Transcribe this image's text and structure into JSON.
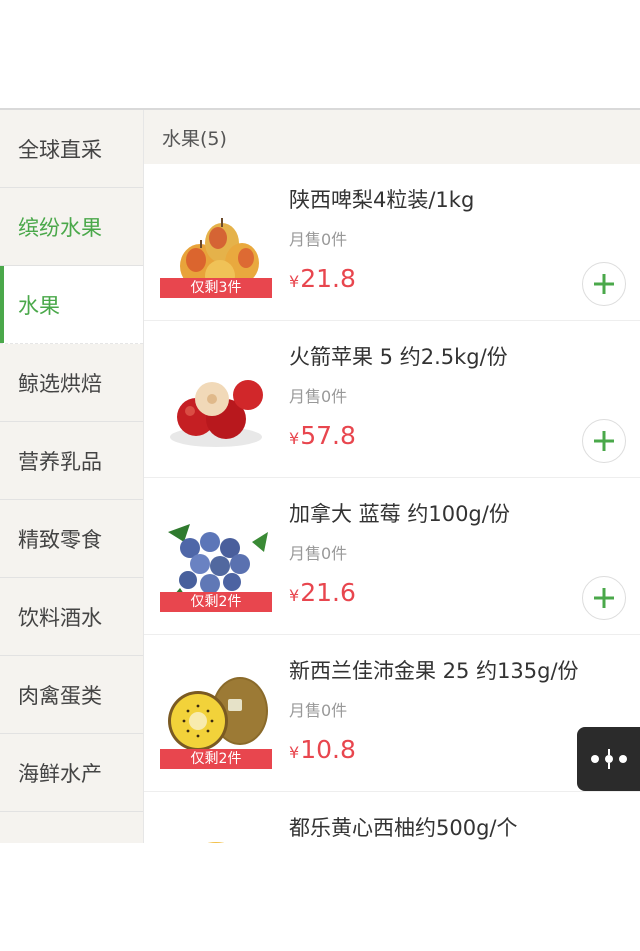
{
  "sidebar": {
    "items": [
      {
        "label": "全球直采"
      },
      {
        "label": "缤纷水果"
      },
      {
        "label": "水果"
      },
      {
        "label": "鲸选烘焙"
      },
      {
        "label": "营养乳品"
      },
      {
        "label": "精致零食"
      },
      {
        "label": "饮料酒水"
      },
      {
        "label": "肉禽蛋类"
      },
      {
        "label": "海鲜水产"
      },
      {
        "label": ""
      }
    ]
  },
  "section": {
    "title": "水果(5)"
  },
  "currency_symbol": "¥",
  "products": [
    {
      "title": "陕西啤梨4粒装/1kg",
      "sales": "月售0件",
      "price": "21.8",
      "stock_badge": "仅剩3件",
      "image": "pear-image"
    },
    {
      "title": "火箭苹果 5 约2.5kg/份",
      "sales": "月售0件",
      "price": "57.8",
      "stock_badge": "",
      "image": "apple-image"
    },
    {
      "title": "加拿大 蓝莓 约100g/份",
      "sales": "月售0件",
      "price": "21.6",
      "stock_badge": "仅剩2件",
      "image": "blueberry-image"
    },
    {
      "title": "新西兰佳沛金果 25 约135g/份",
      "sales": "月售0件",
      "price": "10.8",
      "stock_badge": "仅剩2件",
      "image": "kiwi-image"
    },
    {
      "title": "都乐黄心西柚约500g/个",
      "sales": "",
      "price": "",
      "stock_badge": "",
      "image": "grapefruit-image"
    }
  ],
  "colors": {
    "accent_green": "#4aa84a",
    "price_red": "#e8464e",
    "sidebar_bg": "#f5f3ef"
  },
  "icons": {
    "add": "plus-icon",
    "fab": "more-dots-icon"
  }
}
